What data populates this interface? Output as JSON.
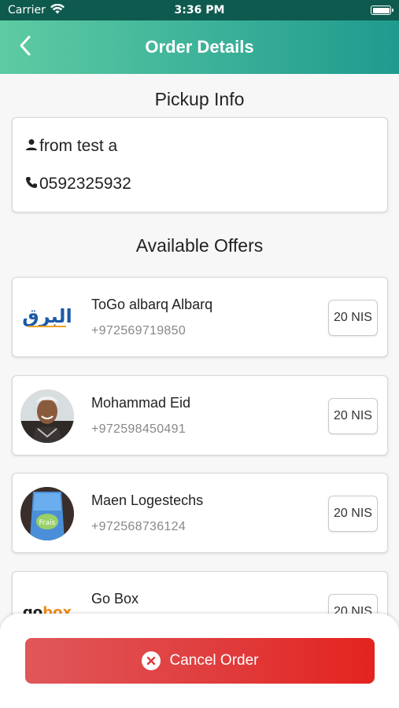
{
  "status_bar": {
    "carrier": "Carrier",
    "time": "3:36 PM"
  },
  "nav": {
    "title": "Order Details"
  },
  "pickup": {
    "section_title": "Pickup Info",
    "name": "from test a",
    "phone": "0592325932"
  },
  "offers": {
    "section_title": "Available Offers",
    "items": [
      {
        "name": "ToGo albarq Albarq",
        "phone": "+972569719850",
        "price": "20 NIS",
        "avatar": "albarq-logo"
      },
      {
        "name": "Mohammad Eid",
        "phone": "+972598450491",
        "price": "20 NIS",
        "avatar": "person-photo"
      },
      {
        "name": "Maen Logestechs",
        "phone": "+972568736124",
        "price": "20 NIS",
        "avatar": "product-photo"
      },
      {
        "name": "Go Box",
        "phone": "",
        "price": "20 NIS",
        "avatar": "gobox-logo"
      }
    ]
  },
  "footer": {
    "cancel_label": "Cancel Order"
  },
  "colors": {
    "nav_start": "#5ecba2",
    "nav_end": "#1f9a8e",
    "cancel": "#e03a3a"
  }
}
